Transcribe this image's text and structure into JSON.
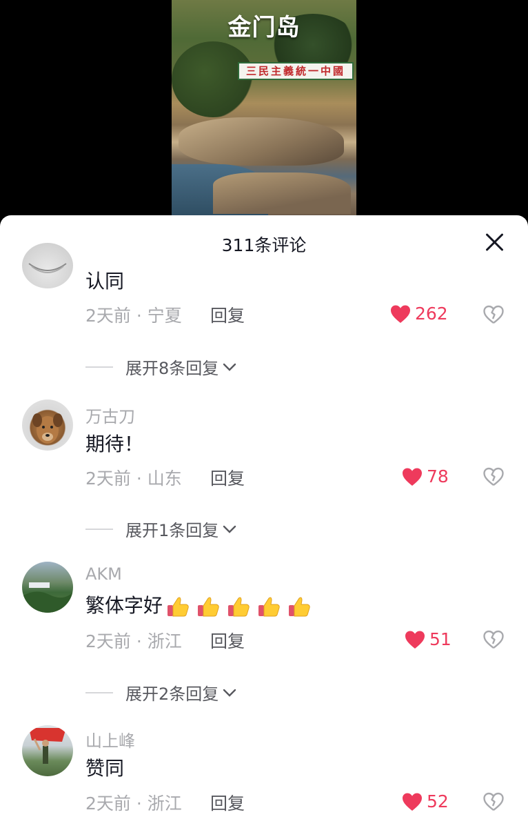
{
  "video": {
    "title": "金门岛",
    "banner": "三民主義統一中國"
  },
  "comments_panel": {
    "title": "311条评论",
    "close_label": "close"
  },
  "comments": [
    {
      "username": "",
      "content": "认同",
      "time_location": "2天前 · 宁夏",
      "reply_label": "回复",
      "likes": "262",
      "expand_label": "展开8条回复"
    },
    {
      "username": "万古刀",
      "content": "期待！",
      "time_location": "2天前 · 山东",
      "reply_label": "回复",
      "likes": "78",
      "expand_label": "展开1条回复"
    },
    {
      "username": "AKM",
      "content": "繁体字好",
      "emoji_count": 5,
      "time_location": "2天前 · 浙江",
      "reply_label": "回复",
      "likes": "51",
      "expand_label": "展开2条回复"
    },
    {
      "username": "山上峰",
      "content": "赞同",
      "time_location": "2天前 · 浙江",
      "reply_label": "回复",
      "likes": "52"
    }
  ],
  "colors": {
    "like_red": "#ee3a5c",
    "text_primary": "#161823",
    "text_secondary": "#a8a9ad"
  },
  "icons": [
    "close-icon",
    "heart-icon",
    "broken-heart-icon",
    "chevron-down-icon",
    "thumbs-up-icon"
  ]
}
